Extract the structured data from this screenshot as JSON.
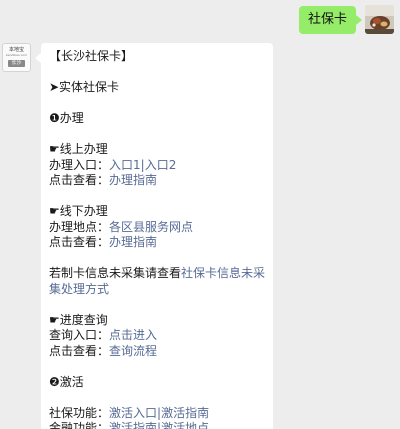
{
  "outgoing": {
    "text": "社保卡"
  },
  "bot_avatar": {
    "brand": "本地宝",
    "brand_sub": "bendibao.com",
    "city": "长沙"
  },
  "message": {
    "title": "【长沙社保卡】",
    "section_physical": "➤实体社保卡",
    "handle_heading": "❶办理",
    "online_heading": "☛线上办理",
    "online_entry_label": "办理入口：",
    "online_entry_link1": "入口1",
    "online_entry_sep": "|",
    "online_entry_link2": "入口2",
    "online_view_label": "点击查看：",
    "online_view_link": "办理指南",
    "offline_heading": "☛线下办理",
    "offline_place_label": "办理地点：",
    "offline_place_link": "各区县服务网点",
    "offline_view_label": "点击查看：",
    "offline_view_link": "办理指南",
    "uncollected_text": "若制卡信息未采集请查看",
    "uncollected_link": "社保卡信息未采集处理方式",
    "progress_heading": "☛进度查询",
    "progress_entry_label": "查询入口：",
    "progress_entry_link": "点击进入",
    "progress_view_label": "点击查看：",
    "progress_view_link": "查询流程",
    "activate_heading": "❷激活",
    "social_func_label": "社保功能：",
    "social_func_link1": "激活入口",
    "social_func_sep": "|",
    "social_func_link2": "激活指南",
    "finance_func_label": "金融功能：",
    "finance_func_link1": "激活指南",
    "finance_func_sep": "|",
    "finance_func_link2": "激活地点"
  },
  "colors": {
    "link": "#576b95",
    "outgoing_bubble": "#95ec69",
    "background": "#ededed"
  }
}
